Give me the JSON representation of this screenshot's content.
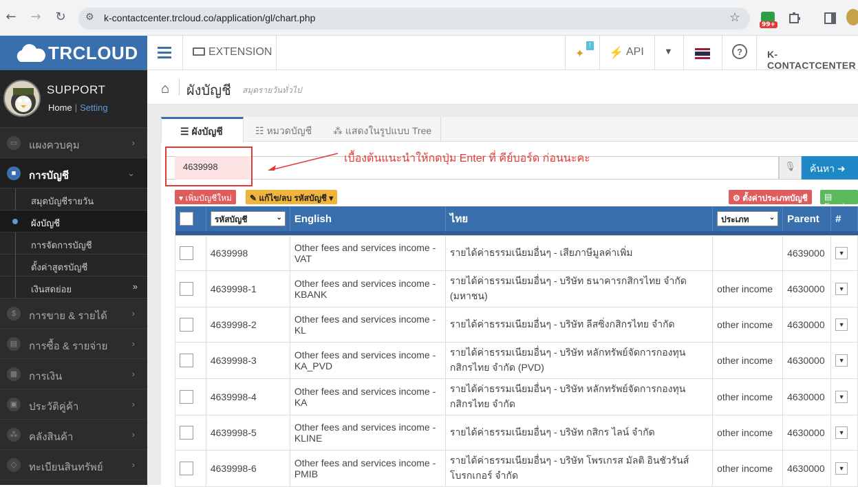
{
  "browser": {
    "url": "k-contactcenter.trcloud.co/application/gl/chart.php",
    "back": "←",
    "forward": "→",
    "reload": "↻",
    "ext_badge": "99+"
  },
  "sidebar": {
    "brand": "TRCLOUD",
    "user_name": "SUPPORT",
    "home_link": "Home",
    "setting_link": "Setting",
    "items": [
      {
        "label": "แผงควบคุม",
        "icon": "monitor-icon"
      },
      {
        "label": "การบัญชี",
        "icon": "book-icon",
        "active": true
      },
      {
        "label": "การขาย & รายได้",
        "icon": "dollar-icon"
      },
      {
        "label": "การซื้อ & รายจ่าย",
        "icon": "cart-icon"
      },
      {
        "label": "การเงิน",
        "icon": "calendar-icon"
      },
      {
        "label": "ประวัติคู่ค้า",
        "icon": "contact-icon"
      },
      {
        "label": "คลังสินค้า",
        "icon": "boxes-icon"
      },
      {
        "label": "ทะเบียนสินทรัพย์",
        "icon": "diamond-icon"
      }
    ],
    "subitems": [
      {
        "label": "สมุดบัญชีรายวัน"
      },
      {
        "label": "ผังบัญชี",
        "current": true
      },
      {
        "label": "การจัดการบัญชี"
      },
      {
        "label": "ตั้งค่าสูตรบัญชี"
      },
      {
        "label": "เงินสดย่อย"
      }
    ]
  },
  "topbar": {
    "extension": "EXTENSION",
    "api": "API",
    "notif_badge": "!",
    "company": "K-CONTACTCENTER"
  },
  "page": {
    "title": "ผังบัญชี",
    "subtitle": "สมุดรายวันทั่วไป"
  },
  "tabs": [
    {
      "label": "ผังบัญชี",
      "active": true
    },
    {
      "label": "หมวดบัญชี"
    },
    {
      "label": "แสดงในรูปแบบ Tree"
    }
  ],
  "search": {
    "value": "4639998",
    "button": "ค้นหา",
    "annotation": "เบื้องต้นแนะนำให้กดปุ่ม Enter ที่ คีย์บอร์ด ก่อนนะคะ"
  },
  "actions": {
    "add": "เพิ่มบัญชีใหม่",
    "edit": "แก้ไข/ลบ รหัสบัญชี",
    "settype": "ตั้งค่าประเภทบัญชี",
    "excel": "Excel"
  },
  "table": {
    "headers": {
      "code": "รหัสบัญชี",
      "english": "English",
      "thai": "ไทย",
      "type": "ประเภท",
      "parent": "Parent",
      "hash": "#"
    },
    "rows": [
      {
        "code": "4639998",
        "en": "Other fees and services income - VAT",
        "th": "รายได้ค่าธรรมเนียมอื่นๆ - เสียภาษีมูลค่าเพิ่ม",
        "type": "",
        "parent": "4639000"
      },
      {
        "code": "4639998-1",
        "en": "Other fees and services income - KBANK",
        "th": "รายได้ค่าธรรมเนียมอื่นๆ - บริษัท ธนาคารกสิกรไทย จำกัด (มหาชน)",
        "type": "other income",
        "parent": "4630000"
      },
      {
        "code": "4639998-2",
        "en": "Other fees and services income - KL",
        "th": "รายได้ค่าธรรมเนียมอื่นๆ - บริษัท ลีสซิ่งกสิกรไทย จำกัด",
        "type": "other income",
        "parent": "4630000"
      },
      {
        "code": "4639998-3",
        "en": "Other fees and services income - KA_PVD",
        "th": "รายได้ค่าธรรมเนียมอื่นๆ - บริษัท หลักทรัพย์จัดการกองทุน กสิกรไทย จำกัด (PVD)",
        "type": "other income",
        "parent": "4630000"
      },
      {
        "code": "4639998-4",
        "en": "Other fees and services income - KA",
        "th": "รายได้ค่าธรรมเนียมอื่นๆ - บริษัท หลักทรัพย์จัดการกองทุน กสิกรไทย จำกัด",
        "type": "other income",
        "parent": "4630000"
      },
      {
        "code": "4639998-5",
        "en": "Other fees and services income - KLINE",
        "th": "รายได้ค่าธรรมเนียมอื่นๆ - บริษัท กสิกร ไลน์ จำกัด",
        "type": "other income",
        "parent": "4630000"
      },
      {
        "code": "4639998-6",
        "en": "Other fees and services income - PMIB",
        "th": "รายได้ค่าธรรมเนียมอื่นๆ - บริษัท โพรเกรส มัลติ อินชัวรันส์ โบรกเกอร์ จำกัด",
        "type": "other income",
        "parent": "4630000"
      }
    ]
  },
  "colors": {
    "brand": "#3a6fae",
    "danger": "#e53935",
    "search_btn": "#1e88c7"
  }
}
